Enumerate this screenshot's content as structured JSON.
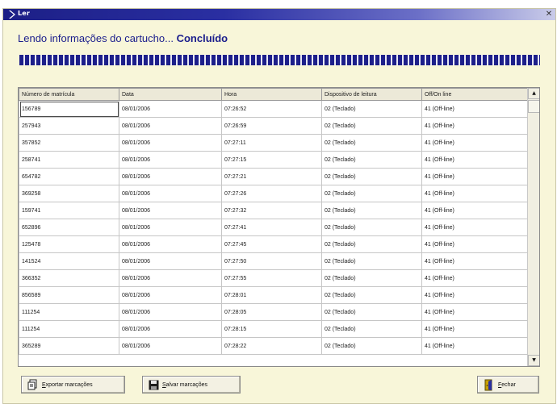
{
  "window": {
    "title": "Ler",
    "close_glyph": "✕",
    "titlebar_icon": "chevron-right-icon"
  },
  "status": {
    "text": "Lendo informações do cartucho...",
    "state": "Concluído"
  },
  "progress": {
    "value_percent": 100,
    "color": "#1d1f8a"
  },
  "table": {
    "columns": [
      "Número de matrícula",
      "Data",
      "Hora",
      "Dispositivo de leitura",
      "Off/On line"
    ],
    "rows": [
      [
        "156789",
        "08/01/2006",
        "07:26:52",
        "02 (Teclado)",
        "41 (Off-line)"
      ],
      [
        "257943",
        "08/01/2006",
        "07:26:59",
        "02 (Teclado)",
        "41 (Off-line)"
      ],
      [
        "357852",
        "08/01/2006",
        "07:27:11",
        "02 (Teclado)",
        "41 (Off-line)"
      ],
      [
        "258741",
        "08/01/2006",
        "07:27:15",
        "02 (Teclado)",
        "41 (Off-line)"
      ],
      [
        "654782",
        "08/01/2006",
        "07:27:21",
        "02 (Teclado)",
        "41 (Off-line)"
      ],
      [
        "369258",
        "08/01/2006",
        "07:27:26",
        "02 (Teclado)",
        "41 (Off-line)"
      ],
      [
        "159741",
        "08/01/2006",
        "07:27:32",
        "02 (Teclado)",
        "41 (Off-line)"
      ],
      [
        "652896",
        "08/01/2006",
        "07:27:41",
        "02 (Teclado)",
        "41 (Off-line)"
      ],
      [
        "125478",
        "08/01/2006",
        "07:27:45",
        "02 (Teclado)",
        "41 (Off-line)"
      ],
      [
        "141524",
        "08/01/2006",
        "07:27:50",
        "02 (Teclado)",
        "41 (Off-line)"
      ],
      [
        "366352",
        "08/01/2006",
        "07:27:55",
        "02 (Teclado)",
        "41 (Off-line)"
      ],
      [
        "856589",
        "08/01/2006",
        "07:28:01",
        "02 (Teclado)",
        "41 (Off-line)"
      ],
      [
        "111254",
        "08/01/2006",
        "07:28:05",
        "02 (Teclado)",
        "41 (Off-line)"
      ],
      [
        "111254",
        "08/01/2006",
        "07:28:15",
        "02 (Teclado)",
        "41 (Off-line)"
      ],
      [
        "365289",
        "08/01/2006",
        "07:28:22",
        "02 (Teclado)",
        "41 (Off-line)"
      ]
    ]
  },
  "scrollbar": {
    "up_glyph": "▲",
    "down_glyph": "▼"
  },
  "buttons": {
    "export": {
      "mnemonic": "E",
      "rest": "xportar marcações",
      "icon": "export-document-icon"
    },
    "save": {
      "mnemonic": "S",
      "rest": "alvar marcações",
      "icon": "floppy-disk-icon"
    },
    "close": {
      "mnemonic": "F",
      "rest": "echar",
      "icon": "door-exit-icon"
    }
  },
  "colors": {
    "window_bg": "#f8f6d9",
    "titlebar": "#1c1f86",
    "status_text": "#1a1d8c"
  }
}
